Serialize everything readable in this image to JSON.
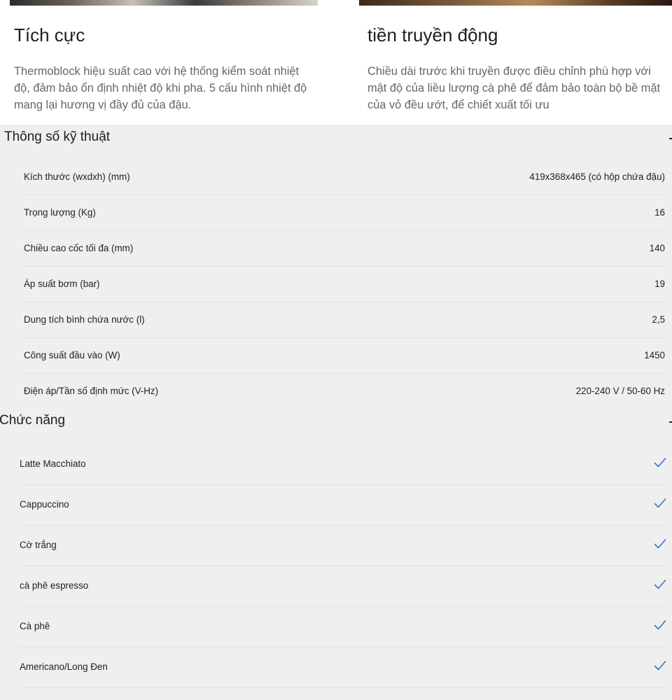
{
  "features": [
    {
      "title": "Tích cực",
      "body": "Thermoblock hiệu suất cao với hệ thống kiểm soát nhiệt độ, đảm bảo ổn định nhiệt độ khi pha. 5 cấu hình nhiệt độ mang lại hương vị đầy đủ của đậu."
    },
    {
      "title": "tiền truyền động",
      "body": "Chiều dài trước khi truyền được điều chỉnh phù hợp với mật độ của liều lượng cà phê để đảm bảo toàn bộ bề mặt của vỏ đều ướt, để chiết xuất tối ưu"
    }
  ],
  "specs": {
    "title": "Thông số kỹ thuật",
    "rows": [
      {
        "label": "Kích thước (wxdxh) (mm)",
        "value": "419x368x465 (có hộp chứa đậu)"
      },
      {
        "label": "Trọng lượng (Kg)",
        "value": "16"
      },
      {
        "label": "Chiều cao cốc tối đa (mm)",
        "value": "140"
      },
      {
        "label": "Áp suất bơm (bar)",
        "value": "19"
      },
      {
        "label": "Dung tích bình chứa nước (l)",
        "value": "2,5"
      },
      {
        "label": "Công suất đầu vào (W)",
        "value": "1450"
      },
      {
        "label": "Điện áp/Tần số định mức (V-Hz)",
        "value": "220-240 V / 50-60 Hz"
      }
    ]
  },
  "functions": {
    "title": "Chức năng",
    "check_color": "#3a73c9",
    "items": [
      {
        "label": "Latte Macchiato"
      },
      {
        "label": "Cappuccino"
      },
      {
        "label": "Cờ trắng"
      },
      {
        "label": "cà phê espresso"
      },
      {
        "label": "Cà phê"
      },
      {
        "label": "Americano/Long Đen"
      }
    ]
  }
}
